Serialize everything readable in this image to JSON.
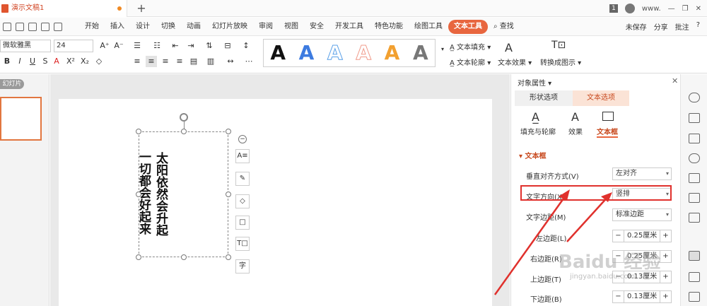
{
  "titlebar": {
    "doc_tab": "演示文稿1",
    "new_tab": "+",
    "badge": "1",
    "user": "www."
  },
  "menu": {
    "items": [
      "开始",
      "插入",
      "设计",
      "切换",
      "动画",
      "幻灯片放映",
      "审阅",
      "视图",
      "安全",
      "开发工具",
      "特色功能",
      "绘图工具",
      "文本工具"
    ],
    "active": "文本工具",
    "search": "查找",
    "right": [
      "未保存",
      "分享",
      "批注",
      "?"
    ]
  },
  "ribbon": {
    "font_name": "微软雅黑",
    "font_size": "24",
    "text_fill": "文本填充",
    "text_outline": "文本轮廓",
    "text_effect": "文本效果",
    "convert": "转换成图示",
    "art_colors": [
      "#111111",
      "#3d7be0",
      "#5aa0e8",
      "#f09a8a",
      "#f2a030",
      "#777777"
    ]
  },
  "left": {
    "slides_label": "幻灯片"
  },
  "slide": {
    "col1": "太阳依然会升起",
    "col2": "一切都会好起来",
    "tools": [
      "A≡",
      "✎",
      "◇",
      "□",
      "T□",
      "字"
    ]
  },
  "panel": {
    "title": "对象属性",
    "tabs": [
      "形状选项",
      "文本选项"
    ],
    "subtabs": [
      "填充与轮廓",
      "效果",
      "文本框"
    ],
    "section": "文本框",
    "rows": [
      {
        "label": "垂直对齐方式(V)",
        "value": "左对齐"
      },
      {
        "label": "文字方向(X)",
        "value": "竖排"
      },
      {
        "label": "文字边距(M)",
        "value": "标准边距"
      }
    ],
    "spins": [
      {
        "label": "左边距(L)",
        "value": "0.25厘米"
      },
      {
        "label": "右边距(R)",
        "value": "0.25厘米"
      },
      {
        "label": "上边距(T)",
        "value": "0.13厘米"
      },
      {
        "label": "下边距(B)",
        "value": "0.13厘米"
      }
    ]
  },
  "watermark": {
    "text": "Baidu 经验",
    "url": "jingyan.baidu.com"
  },
  "colors": {
    "accent": "#e8663f",
    "highlight": "#e0312d"
  }
}
